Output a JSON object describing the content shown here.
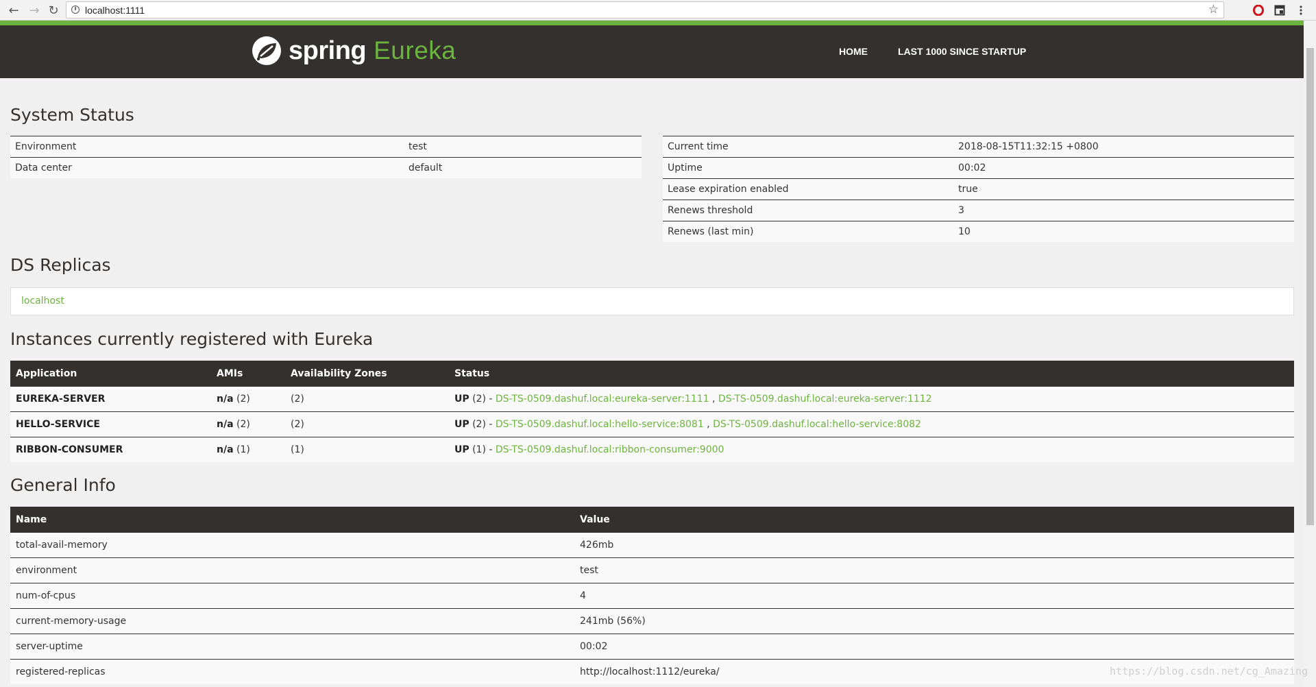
{
  "browser": {
    "url": "localhost:1111",
    "back_icon": "arrow-left-icon",
    "forward_icon": "arrow-right-icon",
    "reload_icon": "reload-icon"
  },
  "header": {
    "logo_word": "spring",
    "logo_product": "Eureka",
    "nav": [
      "HOME",
      "LAST 1000 SINCE STARTUP"
    ]
  },
  "colors": {
    "accent": "#6db33f",
    "dark": "#34302d"
  },
  "system_status": {
    "title": "System Status",
    "left": [
      {
        "label": "Environment",
        "value": "test"
      },
      {
        "label": "Data center",
        "value": "default"
      }
    ],
    "right": [
      {
        "label": "Current time",
        "value": "2018-08-15T11:32:15 +0800"
      },
      {
        "label": "Uptime",
        "value": "00:02"
      },
      {
        "label": "Lease expiration enabled",
        "value": "true"
      },
      {
        "label": "Renews threshold",
        "value": "3"
      },
      {
        "label": "Renews (last min)",
        "value": "10"
      }
    ]
  },
  "replicas": {
    "title": "DS Replicas",
    "items": [
      "localhost"
    ]
  },
  "instances": {
    "title": "Instances currently registered with Eureka",
    "headers": [
      "Application",
      "AMIs",
      "Availability Zones",
      "Status"
    ],
    "rows": [
      {
        "app": "EUREKA-SERVER",
        "amis_label": "n/a",
        "amis_count": "(2)",
        "zones": "(2)",
        "status": "UP",
        "status_count": "(2) -",
        "links": [
          "DS-TS-0509.dashuf.local:eureka-server:1111",
          "DS-TS-0509.dashuf.local:eureka-server:1112"
        ]
      },
      {
        "app": "HELLO-SERVICE",
        "amis_label": "n/a",
        "amis_count": "(2)",
        "zones": "(2)",
        "status": "UP",
        "status_count": "(2) -",
        "links": [
          "DS-TS-0509.dashuf.local:hello-service:8081",
          "DS-TS-0509.dashuf.local:hello-service:8082"
        ]
      },
      {
        "app": "RIBBON-CONSUMER",
        "amis_label": "n/a",
        "amis_count": "(1)",
        "zones": "(1)",
        "status": "UP",
        "status_count": "(1) -",
        "links": [
          "DS-TS-0509.dashuf.local:ribbon-consumer:9000"
        ]
      }
    ]
  },
  "general_info": {
    "title": "General Info",
    "headers": [
      "Name",
      "Value"
    ],
    "rows": [
      {
        "name": "total-avail-memory",
        "value": "426mb"
      },
      {
        "name": "environment",
        "value": "test"
      },
      {
        "name": "num-of-cpus",
        "value": "4"
      },
      {
        "name": "current-memory-usage",
        "value": "241mb (56%)"
      },
      {
        "name": "server-uptime",
        "value": "00:02"
      },
      {
        "name": "registered-replicas",
        "value": "http://localhost:1112/eureka/"
      }
    ]
  },
  "watermark": "https://blog.csdn.net/cg_Amazing"
}
